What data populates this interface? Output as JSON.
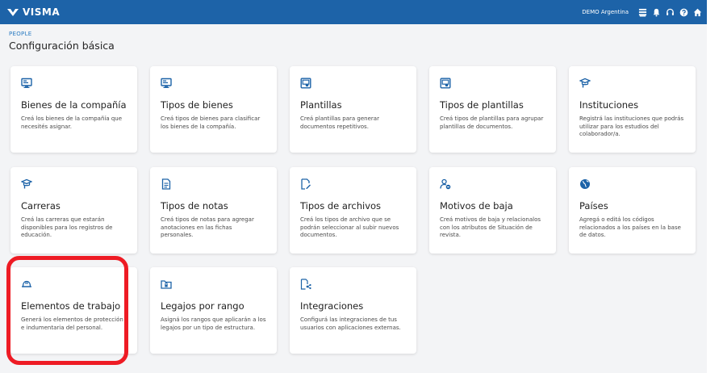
{
  "header": {
    "brand": "VISMA",
    "company": "DEMO Argentina",
    "icons": [
      "list-icon",
      "bell-icon",
      "headset-icon",
      "help-icon",
      "home-icon"
    ]
  },
  "breadcrumb": "PEOPLE",
  "page_title": "Configuración básica",
  "cards": [
    {
      "id": "bienes",
      "icon": "monitor-icon",
      "title": "Bienes de la compañía",
      "desc": "Creá los bienes de la compañía que necesités asignar."
    },
    {
      "id": "tipos-bienes",
      "icon": "monitor-icon",
      "title": "Tipos de bienes",
      "desc": "Creá tipos de bienes para clasificar los bienes de la compañía."
    },
    {
      "id": "plantillas",
      "icon": "template-icon",
      "title": "Plantillas",
      "desc": "Creá plantillas para generar documentos repetitivos."
    },
    {
      "id": "tipos-plantillas",
      "icon": "template-icon",
      "title": "Tipos de plantillas",
      "desc": "Creá tipos de plantillas para agrupar plantillas de documentos."
    },
    {
      "id": "instituciones",
      "icon": "graduation-cap-icon",
      "title": "Instituciones",
      "desc": "Registrá las instituciones que podrás utilizar para los estudios del colaborador/a."
    },
    {
      "id": "carreras",
      "icon": "graduation-cap-icon",
      "title": "Carreras",
      "desc": "Creá las carreras que estarán disponibles para los registros de educación."
    },
    {
      "id": "tipos-notas",
      "icon": "document-icon",
      "title": "Tipos de notas",
      "desc": "Creá tipos de notas para agregar anotaciones en las fichas personales."
    },
    {
      "id": "tipos-archivos",
      "icon": "file-edit-icon",
      "title": "Tipos de archivos",
      "desc": "Creá los tipos de archivo que se podrán seleccionar al subir nuevos documentos."
    },
    {
      "id": "motivos-baja",
      "icon": "user-remove-icon",
      "title": "Motivos de baja",
      "desc": "Creá motivos de baja y relacionalos con los atributos de Situación de revista."
    },
    {
      "id": "paises",
      "icon": "globe-icon",
      "title": "Países",
      "desc": "Agregá o editá los códigos relacionados a los países en la base de datos."
    },
    {
      "id": "elementos-trabajo",
      "icon": "hard-hat-icon",
      "title": "Elementos de trabajo",
      "desc": "Generá los elementos de protección e indumentaria del personal."
    },
    {
      "id": "legajos-rango",
      "icon": "folder-lock-icon",
      "title": "Legajos por rango",
      "desc": "Asigná los rangos que aplicarán a los legajos por un tipo de estructura."
    },
    {
      "id": "integraciones",
      "icon": "integration-icon",
      "title": "Integraciones",
      "desc": "Configurá las integraciones de tus usuarios con aplicaciones externas."
    }
  ],
  "colors": {
    "header_bg": "#1d63a8",
    "accent": "#2a7bc2",
    "highlight": "#ee1b24",
    "page_bg": "#f3f4f6"
  }
}
